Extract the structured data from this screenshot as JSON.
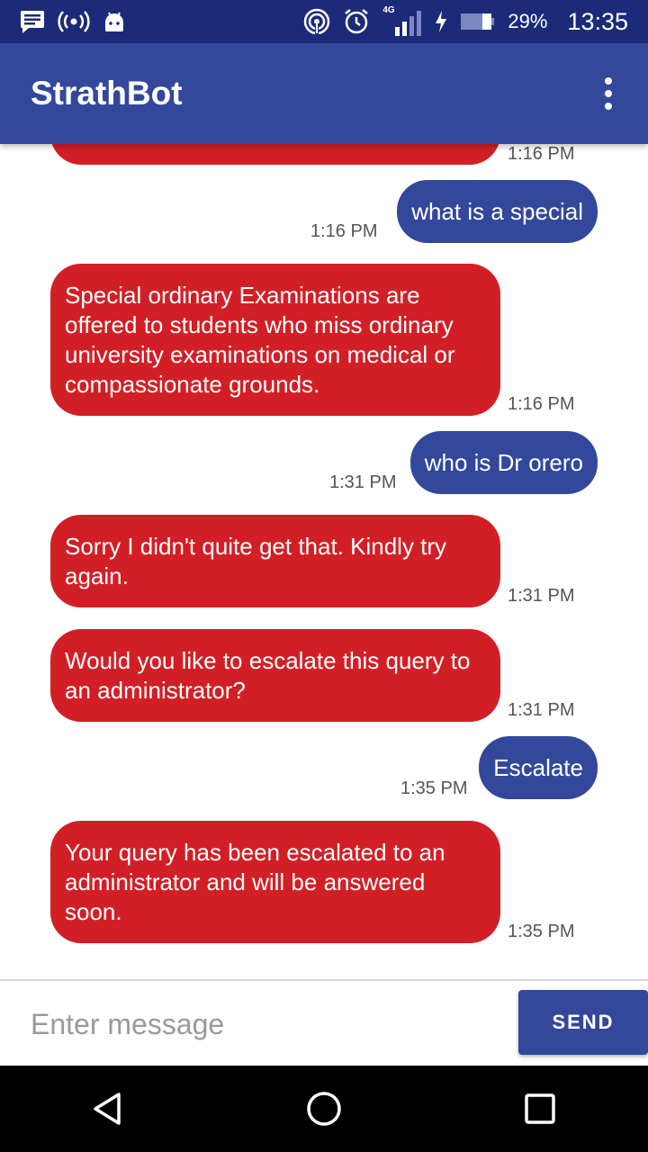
{
  "status_bar": {
    "battery_percent": "29%",
    "clock": "13:35",
    "network_type": "4G",
    "icons": [
      "message-notification-icon",
      "broadcast-icon",
      "android-icon",
      "hotspot-icon",
      "alarm-icon",
      "signal-icon",
      "charging-icon",
      "battery-icon"
    ]
  },
  "app_bar": {
    "title": "StrathBot",
    "menu_icon": "overflow-menu-icon"
  },
  "chat": {
    "partial_top_time": "1:16 PM",
    "messages": [
      {
        "sender": "user",
        "text": "what is a special",
        "time": "1:16 PM"
      },
      {
        "sender": "bot",
        "text": "Special ordinary Examinations are offered to students who miss ordinary university examinations on medical or compassionate grounds.",
        "time": "1:16 PM"
      },
      {
        "sender": "user",
        "text": "who is Dr orero",
        "time": "1:31 PM"
      },
      {
        "sender": "bot",
        "text": "Sorry I didn't quite get that. Kindly try again.",
        "time": "1:31 PM"
      },
      {
        "sender": "bot",
        "text": "Would you like to escalate this query to an administrator?",
        "time": "1:31 PM"
      },
      {
        "sender": "user",
        "text": "Escalate",
        "time": "1:35 PM"
      },
      {
        "sender": "bot",
        "text": "Your query has been escalated to an administrator and will be answered soon.",
        "time": "1:35 PM"
      }
    ]
  },
  "composer": {
    "placeholder": "Enter message",
    "value": "",
    "send_label": "SEND"
  },
  "colors": {
    "status_bar": "#1c2a7a",
    "app_bar": "#33489a",
    "bot_bubble": "#d21f26",
    "user_bubble": "#33489a"
  },
  "nav_bar": {
    "icons": [
      "back-icon",
      "home-icon",
      "recents-icon"
    ]
  }
}
